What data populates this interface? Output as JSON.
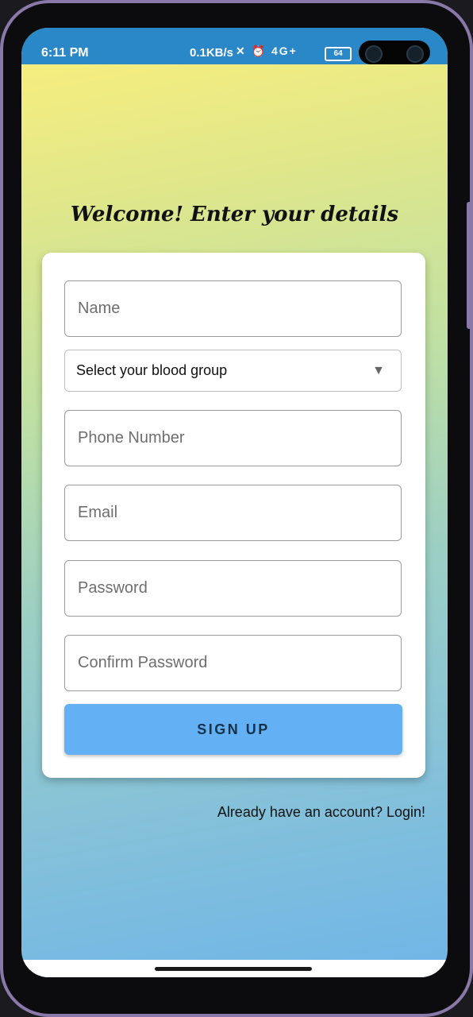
{
  "status_bar": {
    "time": "6:11 PM",
    "net_speed": "0.1KB/s",
    "signal_label": "4G+",
    "battery": "64"
  },
  "form": {
    "heading": "Welcome! Enter your details",
    "name_placeholder": "Name",
    "blood_group_select": "Select your blood group",
    "phone_placeholder": "Phone Number",
    "email_placeholder": "Email",
    "password_placeholder": "Password",
    "confirm_password_placeholder": "Confirm Password",
    "signup_label": "SIGN UP",
    "login_link": "Already have an account? Login!"
  },
  "icons": {
    "select_caret": "caret-down-icon",
    "alarm": "alarm-icon",
    "mute": "notifications-off-icon"
  },
  "colors": {
    "statusbar": "#2a87c8",
    "button": "#63b1f4",
    "gradient_top": "#fbef7c",
    "gradient_bottom": "#6fb5e8"
  }
}
